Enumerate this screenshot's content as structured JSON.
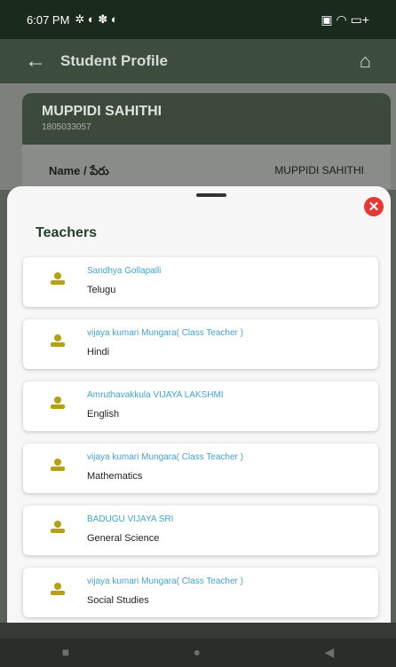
{
  "status_bar": {
    "time": "6:07 PM",
    "left_icons": "✲ ◐ ✽ ◐",
    "right_icons": "▣ ◠ ▭+"
  },
  "app_bar": {
    "title": "Student Profile",
    "back_icon": "←",
    "home_icon": "⌂"
  },
  "profile": {
    "name": "MUPPIDI SAHITHI",
    "id": "1805033057"
  },
  "info_row": {
    "label": "Name / పేరు",
    "value": "MUPPIDI SAHITHI"
  },
  "sheet": {
    "title": "Teachers",
    "close_icon": "✕",
    "teachers": [
      {
        "name": "Sandhya Gollapalli",
        "subject": "Telugu"
      },
      {
        "name": "vijaya kumari Mungara( Class Teacher )",
        "subject": "Hindi"
      },
      {
        "name": "Amruthavakkula VIJAYA LAKSHMI",
        "subject": "English"
      },
      {
        "name": "vijaya kumari Mungara( Class Teacher )",
        "subject": "Mathematics"
      },
      {
        "name": "BADUGU VIJAYA SRI",
        "subject": "General Science"
      },
      {
        "name": "vijaya kumari Mungara( Class Teacher )",
        "subject": "Social Studies"
      }
    ]
  },
  "nav_bar": {
    "recents": "■",
    "home": "●",
    "back": "◀"
  },
  "colors": {
    "accent": "#23402a",
    "teacher_name": "#42a5c8",
    "avatar": "#b5a214",
    "close": "#e53935"
  }
}
